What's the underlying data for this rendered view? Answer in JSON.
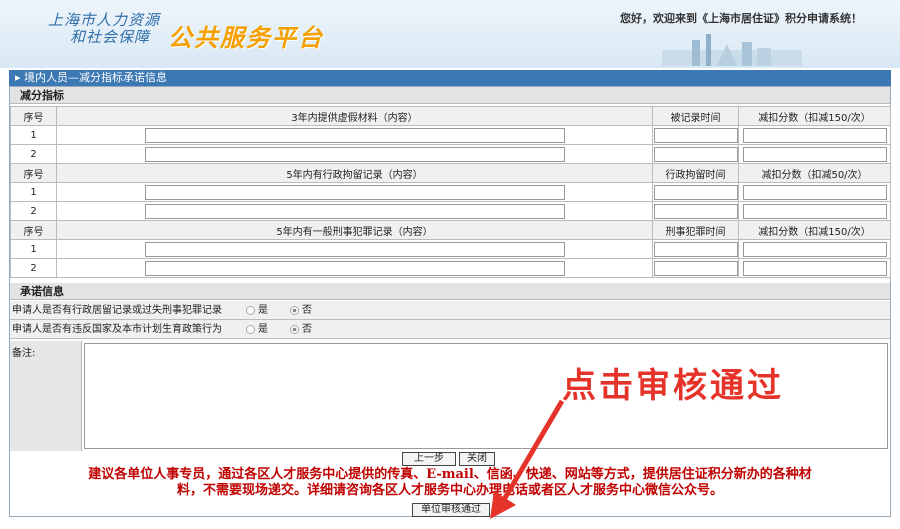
{
  "header": {
    "org_line1": "上海市人力资源",
    "org_line2": "和社会保障",
    "platform": "公共服务平台",
    "welcome": "您好，欢迎来到《上海市居住证》积分申请系统！"
  },
  "title_bar": "境内人员—减分指标承诺信息",
  "deduction": {
    "section_title": "减分指标",
    "groups": [
      {
        "seq_header": "序号",
        "content_header": "3年内提供虚假材料（内容）",
        "time_header": "被记录时间",
        "points_header": "减扣分数（扣减150/次）",
        "rows": [
          "1",
          "2"
        ]
      },
      {
        "seq_header": "序号",
        "content_header": "5年内有行政拘留记录（内容）",
        "time_header": "行政拘留时间",
        "points_header": "减扣分数（扣减50/次）",
        "rows": [
          "1",
          "2"
        ]
      },
      {
        "seq_header": "序号",
        "content_header": "5年内有一般刑事犯罪记录（内容）",
        "time_header": "刑事犯罪时间",
        "points_header": "减扣分数（扣减150/次）",
        "rows": [
          "1",
          "2"
        ]
      }
    ]
  },
  "promise": {
    "section_title": "承诺信息",
    "q1": "申请人是否有行政居留记录或过失刑事犯罪记录",
    "q2": "申请人是否有违反国家及本市计划生育政策行为",
    "yes": "是",
    "no": "否",
    "q1_selected": "否",
    "q2_selected": "否"
  },
  "notes_label": "备注:",
  "buttons": {
    "prev": "上一步",
    "close": "关闭",
    "approve": "单位审核通过"
  },
  "advice_line1": "建议各单位人事专员，通过各区人才服务中心提供的传真、E-mail、信函、快递、网站等方式，提供居住证积分新办的各种材",
  "advice_line2": "料，不需要现场递交。详细请咨询各区人才服务中心办理电话或者区人才服务中心微信公众号。",
  "annotation": "点击审核通过",
  "colors": {
    "title_bar": "#3c78b4",
    "advice": "#c00000",
    "annotation": "#e6332a",
    "logo_orange": "#f5a000"
  }
}
